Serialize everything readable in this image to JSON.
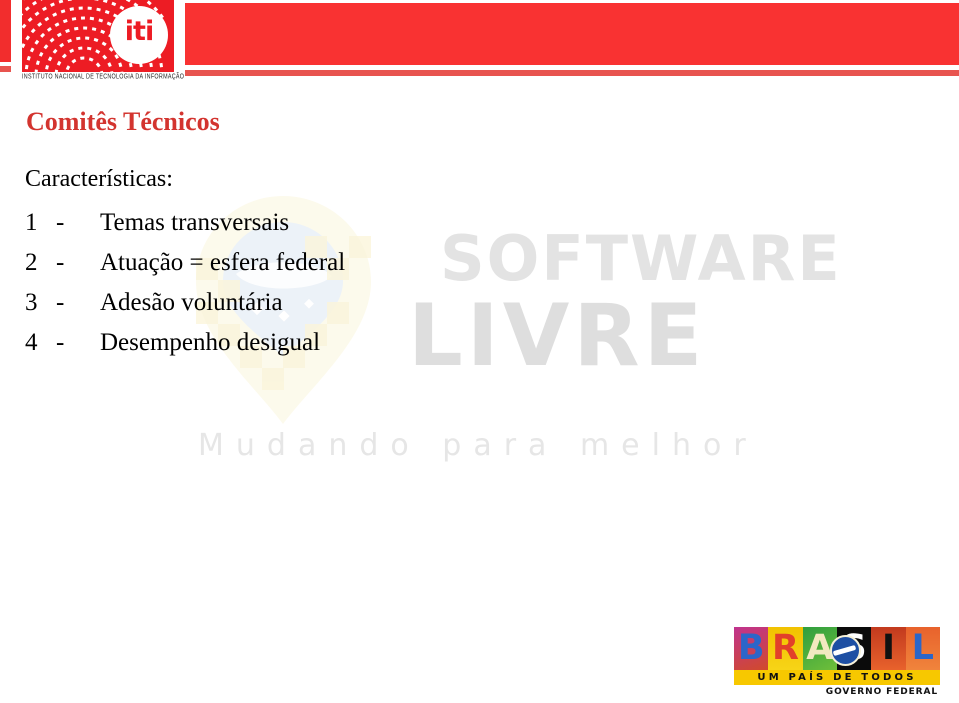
{
  "header": {
    "logo": {
      "wordmark": "iti",
      "caption": "INSTITUTO NACIONAL DE TECNOLOGIA DA INFORMAÇÃO"
    },
    "bar_color": "#f93232",
    "accent_color": "#e8544f"
  },
  "slide": {
    "title": "Comitês Técnicos",
    "title_color": "#d3342f",
    "subtitle": "Características:",
    "items": [
      {
        "num": "1",
        "dash": "-",
        "text": "Temas transversais"
      },
      {
        "num": "2",
        "dash": "-",
        "text": "Atuação = esfera federal"
      },
      {
        "num": "3",
        "dash": "-",
        "text": "Adesão voluntária"
      },
      {
        "num": "4",
        "dash": "-",
        "text": "Desempenho desigual"
      }
    ]
  },
  "watermark": {
    "line1": "SOFTWARE",
    "line2": "LIVRE",
    "tagline": "Mudando para melhor",
    "color": "#e0e0e0"
  },
  "brasil_logo": {
    "letters": [
      "B",
      "R",
      "A",
      "S",
      "I",
      "L"
    ],
    "strip_text": "UM PAÍS DE TODOS",
    "gov_text": "GOVERNO FEDERAL",
    "strip_color": "#f7c800"
  }
}
